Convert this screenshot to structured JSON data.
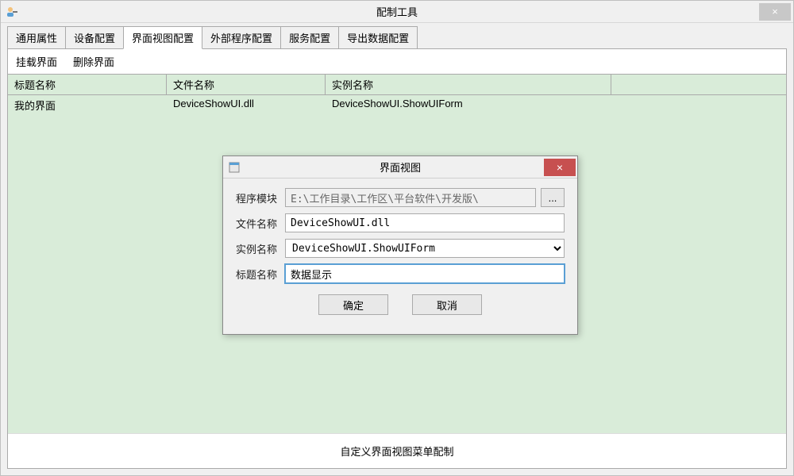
{
  "window": {
    "title": "配制工具",
    "close_label": "×"
  },
  "tabs": [
    {
      "label": "通用属性"
    },
    {
      "label": "设备配置"
    },
    {
      "label": "界面视图配置"
    },
    {
      "label": "外部程序配置"
    },
    {
      "label": "服务配置"
    },
    {
      "label": "导出数据配置"
    }
  ],
  "toolbar": {
    "mount_label": "挂载界面",
    "delete_label": "删除界面"
  },
  "grid": {
    "headers": {
      "col1": "标题名称",
      "col2": "文件名称",
      "col3": "实例名称"
    },
    "row": {
      "col1": "我的界面",
      "col2": "DeviceShowUI.dll",
      "col3": "DeviceShowUI.ShowUIForm"
    }
  },
  "footer": {
    "text": "自定义界面视图菜单配制"
  },
  "dialog": {
    "title": "界面视图",
    "close_label": "×",
    "labels": {
      "module": "程序模块",
      "file": "文件名称",
      "instance": "实例名称",
      "caption": "标题名称"
    },
    "values": {
      "module": "E:\\工作目录\\工作区\\平台软件\\开发版\\",
      "file": "DeviceShowUI.dll",
      "instance": "DeviceShowUI.ShowUIForm",
      "caption": "数据显示"
    },
    "browse": "...",
    "ok": "确定",
    "cancel": "取消"
  }
}
